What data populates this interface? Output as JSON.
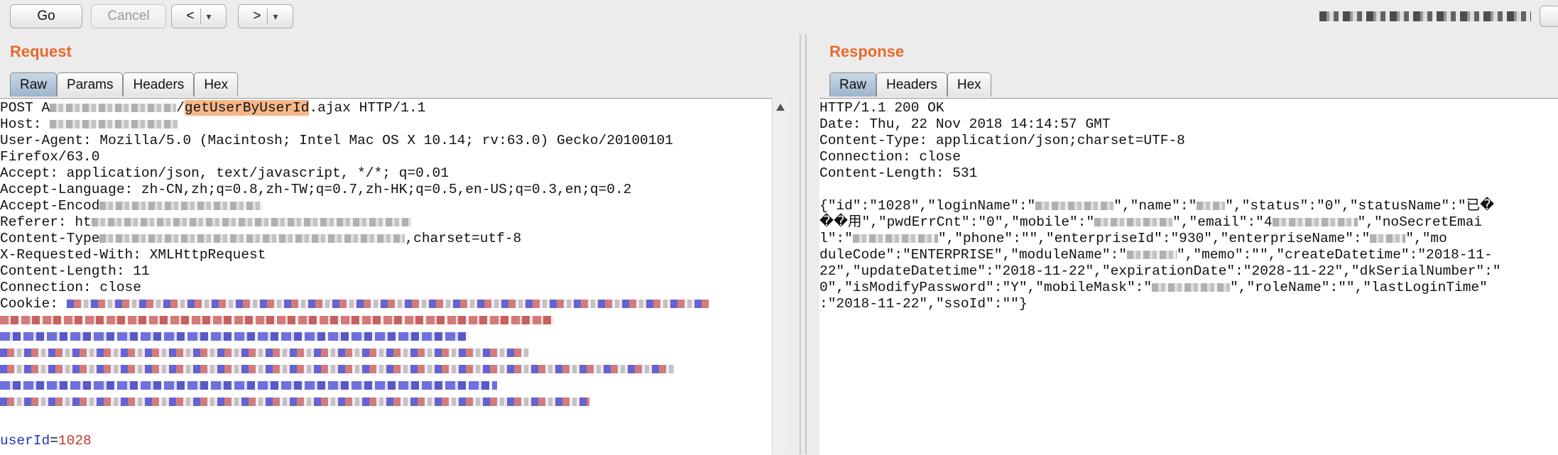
{
  "toolbar": {
    "go_label": "Go",
    "cancel_label": "Cancel",
    "back_label": "<",
    "forward_label": ">",
    "dropdown_glyph": "▾"
  },
  "request": {
    "title": "Request",
    "tabs": [
      {
        "label": "Raw",
        "active": true
      },
      {
        "label": "Params",
        "active": false
      },
      {
        "label": "Headers",
        "active": false
      },
      {
        "label": "Hex",
        "active": false
      }
    ],
    "lines": {
      "l1_method": "POST ",
      "l1_path_prefix": "A",
      "l1_slash": "/",
      "l1_highlight": "getUserByUserId",
      "l1_suffix": ".ajax HTTP/1.1",
      "l2": "Host: ",
      "l3": "User-Agent: Mozilla/5.0 (Macintosh; Intel Mac OS X 10.14; rv:63.0) Gecko/20100101",
      "l4": "Firefox/63.0",
      "l5": "Accept: application/json, text/javascript, */*; q=0.01",
      "l6": "Accept-Language: zh-CN,zh;q=0.8,zh-TW;q=0.7,zh-HK;q=0.5,en-US;q=0.3,en;q=0.2",
      "l7": "Accept-Encod",
      "l8": "Referer: ht",
      "l9_prefix": "Content-Type",
      "l9_suffix": ",charset=utf-8",
      "l10": "X-Requested-With: XMLHttpRequest",
      "l11": "Content-Length: 11",
      "l12": "Connection: close",
      "l13": "Cookie: ",
      "param_name": "userId",
      "param_eq": "=",
      "param_value": "1028"
    }
  },
  "response": {
    "title": "Response",
    "tabs": [
      {
        "label": "Raw",
        "active": true
      },
      {
        "label": "Headers",
        "active": false
      },
      {
        "label": "Hex",
        "active": false
      }
    ],
    "lines": {
      "l1": "HTTP/1.1 200 OK",
      "l2": "Date: Thu, 22 Nov 2018 14:14:57 GMT",
      "l3": "Content-Type: application/json;charset=UTF-8",
      "l4": "Connection: close",
      "l5": "Content-Length: 531",
      "b1a": "{\"id\":\"1028\",\"loginName\":\"",
      "b1b": "\",\"name\":\"",
      "b1c": "\",\"status\":\"0\",\"statusName\":\"已�",
      "b2a": "��用\",\"pwdErrCnt\":\"0\",\"mobile\":\"",
      "b2b": "\",\"email\":\"4",
      "b2c": "\",\"noSecretEmai",
      "b3a": "l\":\"",
      "b3b": "\",\"phone\":\"\",\"enterpriseId\":\"930\",\"enterpriseName\":\"",
      "b3c": "\",\"mo",
      "b4a": "duleCode\":\"ENTERPRISE\",\"moduleName\":\"",
      "b4b": "\",\"memo\":\"\",\"createDatetime\":\"2018-11-",
      "b5": "22\",\"updateDatetime\":\"2018-11-22\",\"expirationDate\":\"2028-11-22\",\"dkSerialNumber\":\"",
      "b6a": "0\",\"isModifyPassword\":\"Y\",\"mobileMask\":\"",
      "b6b": "\",\"roleName\":\"\",\"lastLoginTime\"",
      "b7": ":\"2018-11-22\",\"ssoId\":\"\"}"
    }
  }
}
